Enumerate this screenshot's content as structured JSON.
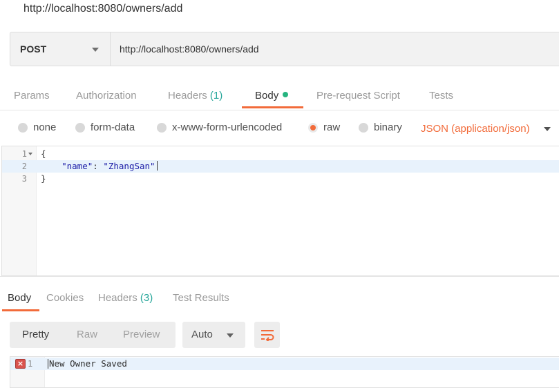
{
  "window": {
    "title": "http://localhost:8080/owners/add"
  },
  "request": {
    "method": "POST",
    "url": "http://localhost:8080/owners/add"
  },
  "request_tabs": {
    "params": "Params",
    "authorization": "Authorization",
    "headers": "Headers",
    "headers_count": "(1)",
    "body": "Body",
    "pre_request": "Pre-request Script",
    "tests": "Tests"
  },
  "body_options": {
    "none": "none",
    "form_data": "form-data",
    "urlencoded": "x-www-form-urlencoded",
    "raw": "raw",
    "binary": "binary",
    "selected": "raw",
    "content_type": "JSON (application/json)"
  },
  "editor": {
    "lines": [
      {
        "num": "1",
        "open_brace": "{"
      },
      {
        "num": "2",
        "key": "\"name\"",
        "sep": ": ",
        "value": "\"ZhangSan\""
      },
      {
        "num": "3",
        "close_brace": "}"
      }
    ]
  },
  "response_tabs": {
    "body": "Body",
    "cookies": "Cookies",
    "headers": "Headers",
    "headers_count": "(3)",
    "test_results": "Test Results"
  },
  "response_format": {
    "pretty": "Pretty",
    "raw": "Raw",
    "preview": "Preview",
    "selected": "Pretty",
    "language": "Auto"
  },
  "response": {
    "line_num": "1",
    "text": "New Owner Saved",
    "error_icon": "×"
  },
  "colors": {
    "accent": "#f26b3a",
    "count_green": "#26a69a",
    "body_dot": "#26b47f",
    "error_red": "#d9534f"
  }
}
